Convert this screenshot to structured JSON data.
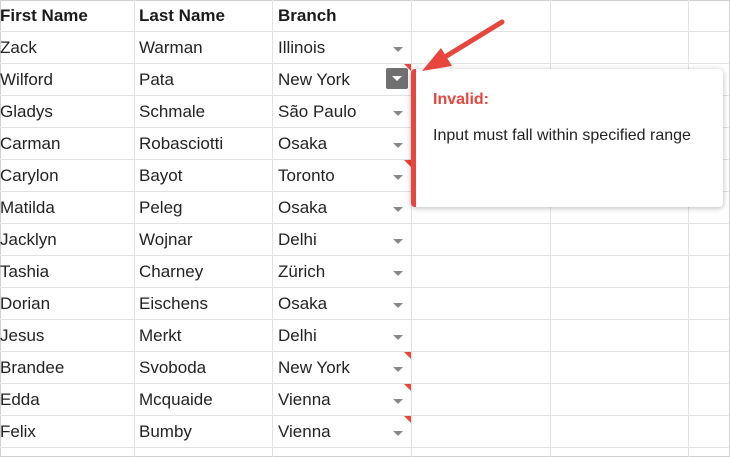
{
  "columns": [
    "First Name",
    "Last Name",
    "Branch"
  ],
  "rows": [
    {
      "first": "Zack",
      "last": "Warman",
      "branch": "Illinois",
      "flag": false
    },
    {
      "first": "Wilford",
      "last": "Pata",
      "branch": "New York",
      "flag": true,
      "active": true
    },
    {
      "first": "Gladys",
      "last": "Schmale",
      "branch": "São Paulo",
      "flag": false
    },
    {
      "first": "Carman",
      "last": "Robasciotti",
      "branch": "Osaka",
      "flag": false
    },
    {
      "first": "Carylon",
      "last": "Bayot",
      "branch": "Toronto",
      "flag": true
    },
    {
      "first": "Matilda",
      "last": "Peleg",
      "branch": "Osaka",
      "flag": false
    },
    {
      "first": "Jacklyn",
      "last": "Wojnar",
      "branch": "Delhi",
      "flag": false
    },
    {
      "first": "Tashia",
      "last": "Charney",
      "branch": "Zürich",
      "flag": false
    },
    {
      "first": "Dorian",
      "last": "Eischens",
      "branch": "Osaka",
      "flag": false
    },
    {
      "first": "Jesus",
      "last": "Merkt",
      "branch": "Delhi",
      "flag": false
    },
    {
      "first": "Brandee",
      "last": "Svoboda",
      "branch": "New York",
      "flag": true
    },
    {
      "first": "Edda",
      "last": "Mcquaide",
      "branch": "Vienna",
      "flag": true
    },
    {
      "first": "Felix",
      "last": "Bumby",
      "branch": "Vienna",
      "flag": true
    }
  ],
  "tooltip": {
    "title": "Invalid:",
    "message": "Input must fall within specified range"
  },
  "icons": {
    "dropdown": "chevron-down-icon",
    "error_flag": "error-flag-icon",
    "annotation_arrow": "annotation-arrow"
  },
  "colors": {
    "error": "#e8453c",
    "grid": "#e2e2e2",
    "dropdown_active_bg": "#707070"
  }
}
